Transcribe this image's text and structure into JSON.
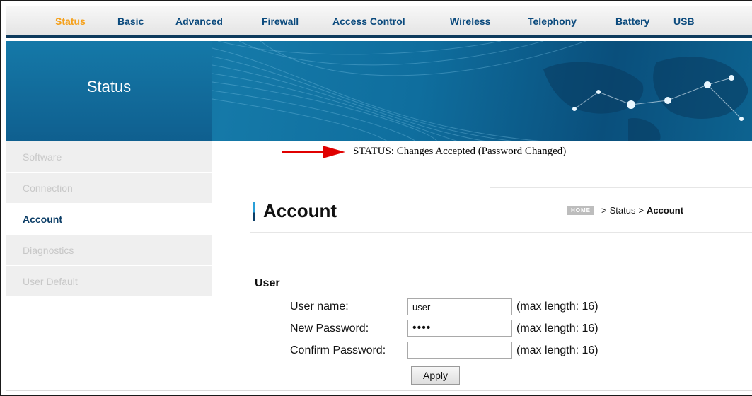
{
  "nav": {
    "items": [
      {
        "label": "Status",
        "active": true
      },
      {
        "label": "Basic",
        "active": false
      },
      {
        "label": "Advanced",
        "active": false
      },
      {
        "label": "Firewall",
        "active": false
      },
      {
        "label": "Access Control",
        "active": false
      },
      {
        "label": "Wireless",
        "active": false
      },
      {
        "label": "Telephony",
        "active": false
      },
      {
        "label": "Battery",
        "active": false
      },
      {
        "label": "USB",
        "active": false
      }
    ]
  },
  "banner": {
    "title": "Status"
  },
  "sidebar": {
    "items": [
      {
        "label": "Software",
        "active": false
      },
      {
        "label": "Connection",
        "active": false
      },
      {
        "label": "Account",
        "active": true
      },
      {
        "label": "Diagnostics",
        "active": false
      },
      {
        "label": "User Default",
        "active": false
      }
    ]
  },
  "status_message": "STATUS: Changes Accepted (Password Changed)",
  "page": {
    "title": "Account",
    "breadcrumb": {
      "home": "HOME",
      "sep1": ">",
      "parent": "Status",
      "sep2": ">",
      "current": "Account"
    }
  },
  "form": {
    "section": "User",
    "username": {
      "label": "User name:",
      "value": "user",
      "hint": "(max length: 16)"
    },
    "new_password": {
      "label": "New Password:",
      "masked": "••••",
      "hint": "(max length: 16)"
    },
    "confirm_password": {
      "label": "Confirm Password:",
      "masked": "",
      "hint": "(max length: 16)"
    },
    "apply_label": "Apply"
  },
  "colors": {
    "nav_text": "#0b4a7d",
    "nav_active": "#f5a01a",
    "banner": "#1579a8",
    "annotation_arrow": "#e00000"
  }
}
